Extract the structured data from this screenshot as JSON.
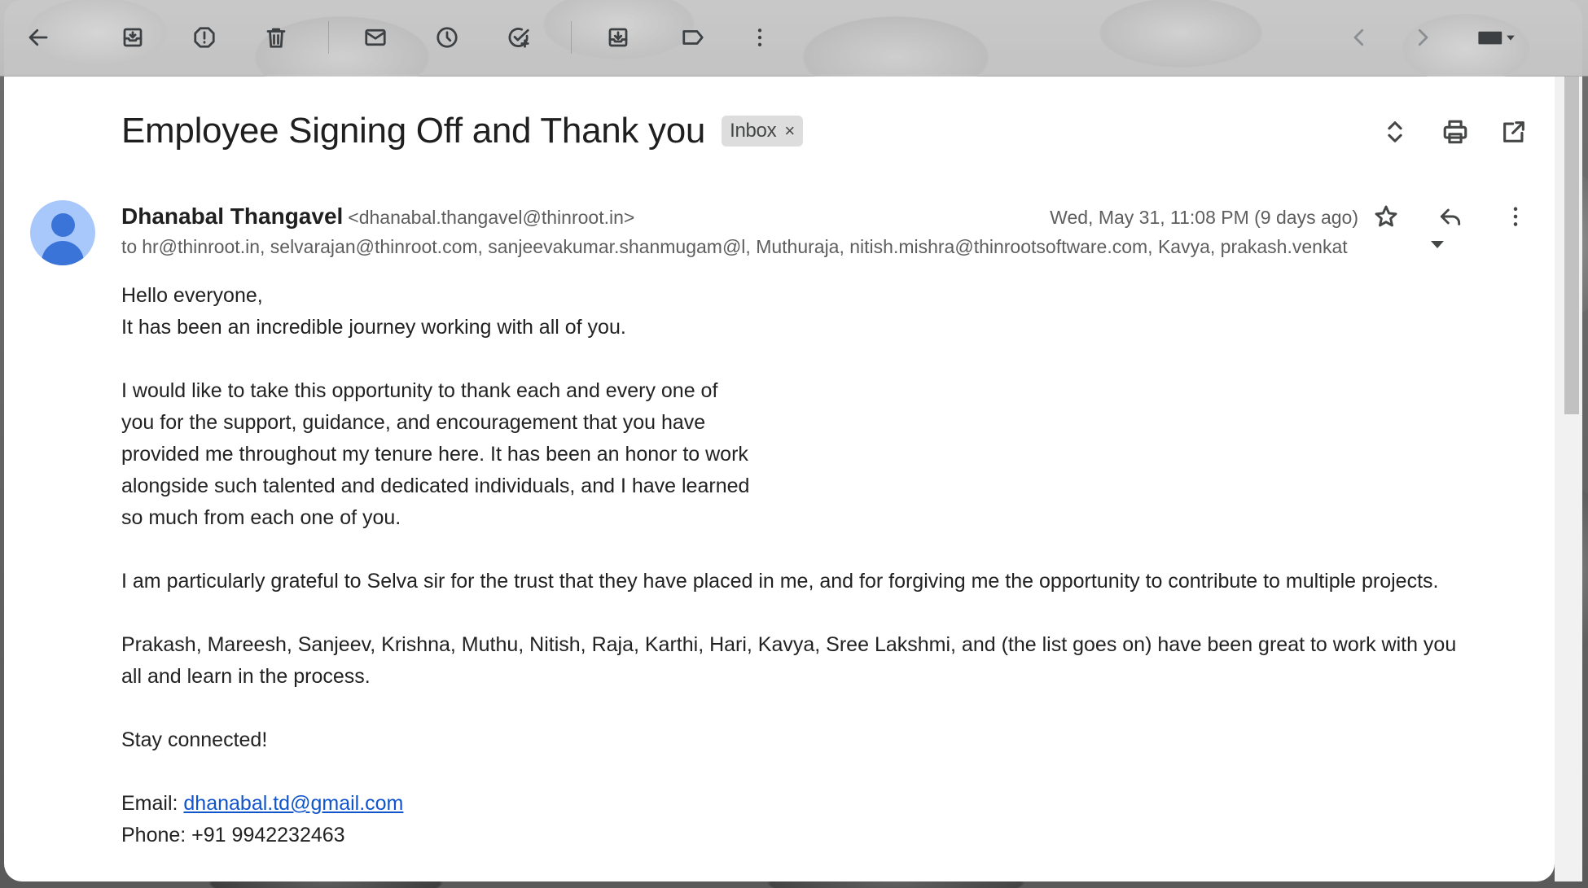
{
  "toolbar": {
    "buttons": [
      {
        "name": "back",
        "icon": "arrow-left-icon"
      },
      {
        "name": "archive",
        "icon": "archive-icon"
      },
      {
        "name": "report-spam",
        "icon": "report-spam-icon"
      },
      {
        "name": "delete",
        "icon": "trash-icon"
      },
      {
        "name": "mark-unread",
        "icon": "mail-icon"
      },
      {
        "name": "snooze",
        "icon": "clock-icon"
      },
      {
        "name": "add-to-tasks",
        "icon": "add-task-icon"
      },
      {
        "name": "move-to",
        "icon": "move-to-icon"
      },
      {
        "name": "labels",
        "icon": "label-icon"
      },
      {
        "name": "more",
        "icon": "more-vert-icon"
      },
      {
        "name": "newer",
        "icon": "chevron-left-icon"
      },
      {
        "name": "older",
        "icon": "chevron-right-icon"
      },
      {
        "name": "input-tools",
        "icon": "keyboard-icon"
      }
    ]
  },
  "email": {
    "subject": "Employee Signing Off and Thank you",
    "label": "Inbox",
    "label_close": "×",
    "sender_name": "Dhanabal Thangavel",
    "sender_email": "<dhanabal.thangavel@thinroot.in>",
    "date": "Wed, May 31, 11:08 PM (9 days ago)",
    "to_prefix": "to",
    "recipients": "hr@thinroot.in, selvarajan@thinroot.com, sanjeevakumar.shanmugam@l, Muthuraja, nitish.mishra@thinrootsoftware.com, Kavya, prakash.venkat",
    "body": {
      "greeting": "Hello everyone,",
      "line1": "It has been an incredible journey working with all of you.",
      "para2": [
        "I would like to take this opportunity to thank each and every one of",
        "you for the support, guidance, and encouragement that you have",
        "provided me throughout my tenure here. It has been an honor to work",
        "alongside such talented and dedicated individuals, and I have learned",
        "so much from each one of you."
      ],
      "para3": "I am particularly grateful to Selva sir for the trust that they have placed in me, and for forgiving me the opportunity to contribute to multiple projects.",
      "para4_line1": "Prakash, Mareesh, Sanjeev, Krishna, Muthu, Nitish, Raja, Karthi, Hari, Kavya, Sree Lakshmi, and  (the list goes on) have been great to work with you",
      "para4_line2": "all and learn in the process.",
      "closing": "Stay connected!",
      "email_label": "Email: ",
      "email_link": "dhanabal.td@gmail.com",
      "phone": "Phone: +91 9942232463"
    }
  },
  "colors": {
    "link": "#1155cc",
    "avatar_bg": "#a8c7fa",
    "avatar_fg": "#3b74d9",
    "chip_bg": "#dddddd"
  }
}
